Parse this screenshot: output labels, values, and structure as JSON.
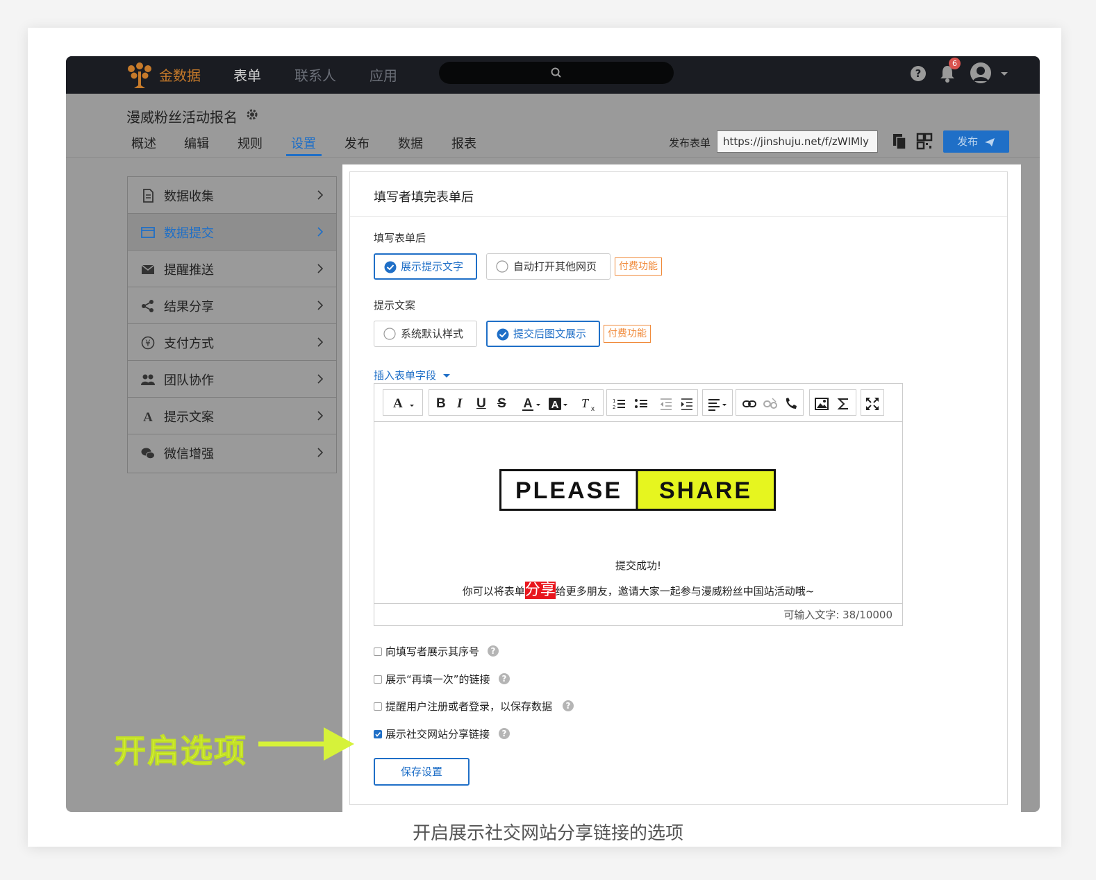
{
  "header": {
    "brand": "金数据",
    "nav": [
      "表单",
      "联系人",
      "应用"
    ],
    "notification_count": "6",
    "colors": {
      "topbar": "#1a1c22",
      "brand": "#c67a2a",
      "accent": "#1f6fc7"
    }
  },
  "form": {
    "title": "漫威粉丝活动报名",
    "tabs": [
      "概述",
      "编辑",
      "规则",
      "设置",
      "发布",
      "数据",
      "报表"
    ],
    "active_tab": "设置",
    "publish_label": "发布表单",
    "publish_url": "https://jinshuju.net/f/zWIMly",
    "publish_button": "发布"
  },
  "sidebar": {
    "items": [
      {
        "label": "数据收集",
        "icon": "document-icon"
      },
      {
        "label": "数据提交",
        "icon": "window-icon",
        "active": true
      },
      {
        "label": "提醒推送",
        "icon": "envelope-icon"
      },
      {
        "label": "结果分享",
        "icon": "share-icon"
      },
      {
        "label": "支付方式",
        "icon": "yen-icon"
      },
      {
        "label": "团队协作",
        "icon": "team-icon"
      },
      {
        "label": "提示文案",
        "icon": "letter-a-icon"
      },
      {
        "label": "微信增强",
        "icon": "wechat-icon"
      }
    ]
  },
  "panel": {
    "title": "填写者填完表单后",
    "after_fill_label": "填写表单后",
    "after_fill_options": [
      "展示提示文字",
      "自动打开其他网页"
    ],
    "paid_badge": "付费功能",
    "tip_label": "提示文案",
    "tip_options": [
      "系统默认样式",
      "提交后图文展示"
    ],
    "insert_field": "插入表单字段",
    "editor": {
      "image_left": "PLEASE",
      "image_right": "SHARE",
      "success_text": "提交成功!",
      "invite_before": "你可以将表单",
      "invite_highlight": "分享",
      "invite_after": "给更多朋友，邀请大家一起参与漫威粉丝中国站活动哦~",
      "counter": "可输入文字: 38/10000"
    },
    "checkboxes": [
      {
        "label": "向填写者展示其序号",
        "checked": false
      },
      {
        "label": "展示“再填一次”的链接",
        "checked": false
      },
      {
        "label": "提醒用户注册或者登录，以保存数据",
        "checked": false
      },
      {
        "label": "展示社交网站分享链接",
        "checked": true
      }
    ],
    "save_button": "保存设置"
  },
  "annotation": {
    "text": "开启选项",
    "color": "#d6f23a"
  },
  "caption": "开启展示社交网站分享链接的选项"
}
